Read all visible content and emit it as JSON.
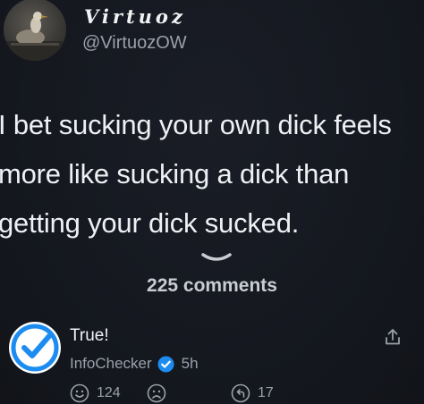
{
  "tweet": {
    "display_name": "Virtuoz",
    "handle": "@VirtuozOW",
    "text_lines": [
      "I bet sucking your own dick feels",
      "more like sucking a dick than",
      "getting your dick sucked."
    ]
  },
  "comments_section": {
    "count_label": "225 comments"
  },
  "comment": {
    "text": "True!",
    "author": "InfoChecker",
    "time": "5h",
    "likes": "124",
    "replies": "17"
  },
  "colors": {
    "background": "#15181f",
    "verified_blue": "#1d8cf0",
    "muted_text": "#9aa0ab"
  },
  "icons": [
    "chevron-down-icon",
    "share-icon",
    "verified-icon",
    "smile-icon",
    "frown-icon",
    "reply-icon"
  ]
}
